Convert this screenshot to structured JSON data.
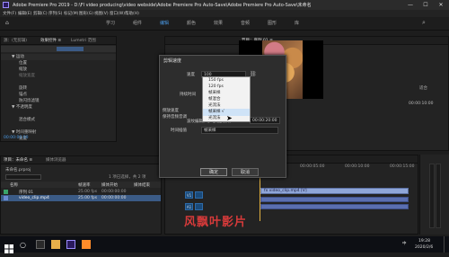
{
  "titlebar": {
    "title": "Adobe Premiere Pro 2019 - D:\\Fl video producing\\video webside\\Adobe Premiere Pro Auto-Save\\Adobe Premiere Pro Auto-Save\\未命名",
    "minimize": "—",
    "maximize": "☐",
    "close": "✕"
  },
  "menubar": [
    "文件(F)",
    "编辑(E)",
    "剪辑(C)",
    "序列(S)",
    "标记(M)",
    "图形(G)",
    "视图(V)",
    "窗口(W)",
    "帮助(H)"
  ],
  "workspaces": [
    "学习",
    "组件",
    "编辑",
    "颜色",
    "效果",
    "音频",
    "图形",
    "库"
  ],
  "effect_controls": {
    "tab_label": "源：(无剪辑)",
    "tab2_label": "效果控件 ≡",
    "tab3_label": "Lumetri 范围",
    "tab4_label": "音频剪辑混合器",
    "rows": [
      {
        "label": "▼ 运动",
        "value": ""
      },
      {
        "label": "位置",
        "value": ""
      },
      {
        "label": "缩放",
        "value": ""
      },
      {
        "label": "缩放宽度",
        "value": ""
      },
      {
        "label": "",
        "value": ""
      },
      {
        "label": "旋转",
        "value": ""
      },
      {
        "label": "锚点",
        "value": ""
      },
      {
        "label": "防闪烁滤镜",
        "value": ""
      },
      {
        "label": "▼ 不透明度",
        "value": ""
      },
      {
        "label": "",
        "value": ""
      },
      {
        "label": "混合模式",
        "value": ""
      },
      {
        "label": "",
        "value": ""
      },
      {
        "label": "▼ 时间重映射",
        "value": ""
      },
      {
        "label": "速度",
        "value": ""
      }
    ],
    "timecode": "00:00:00:00"
  },
  "project": {
    "tab_label": "项目：未命名 ≡",
    "tab2_label": "媒体浏览器",
    "file": "未命名.prproj",
    "count": "1 项已选择，共 2 项",
    "columns": [
      "名称",
      "帧速率",
      "媒体开始",
      "媒体结束"
    ],
    "items": [
      {
        "name": "序列 01",
        "fps": "25.00 fps",
        "start": "00:00:00:00",
        "end": ""
      },
      {
        "name": "video_clip.mp4",
        "fps": "25.00 fps",
        "start": "00:00:00:00",
        "end": ""
      }
    ]
  },
  "program_monitor": {
    "tab_label": "节目：序列 01 ≡",
    "timecode_right": "00:00:10:00",
    "fit": "适合"
  },
  "dialog": {
    "title": "剪辑速度",
    "label_speed": "速度",
    "speed_value": "100",
    "label_duration": "持续时间",
    "label_reverse": "倒放速度",
    "label_keep_pitch": "保持音频音调",
    "label_ripple": "波纹编辑，移动尾部剪辑",
    "label_interp": "时间插值",
    "interp_value": "帧采样",
    "duration_value": "00:00:20:00",
    "selected_value": "帧采样",
    "ok": "确定",
    "cancel": "取消"
  },
  "dropdown": {
    "items": [
      "150 fps",
      "120 fps",
      "帧采样",
      "帧混合",
      "光流法",
      "帧采样 √",
      "光流法"
    ],
    "selected_index": 5
  },
  "timeline": {
    "tab_label": "序列 01 ≡",
    "timecode": "00:00:00:00",
    "ruler": [
      "00:00",
      "00:00:05:00",
      "00:00:10:00",
      "00:00:15:00"
    ],
    "tracks": [
      "V3",
      "V2",
      "V1",
      "A1",
      "A2",
      "A3"
    ],
    "clip_label": "fx video_clip.mp4 [V]"
  },
  "watermark": "风飘叶影片",
  "taskbar": {
    "time": "19:28",
    "date": "2020/2/6",
    "search_hint": "在这里输入你要搜索的内容",
    "lang": "中"
  },
  "colors": {
    "accent": "#4a9be8",
    "clip_video": "#8fa6d8",
    "clip_audio": "#5a6fb0",
    "watermark": "#d63a3a"
  }
}
